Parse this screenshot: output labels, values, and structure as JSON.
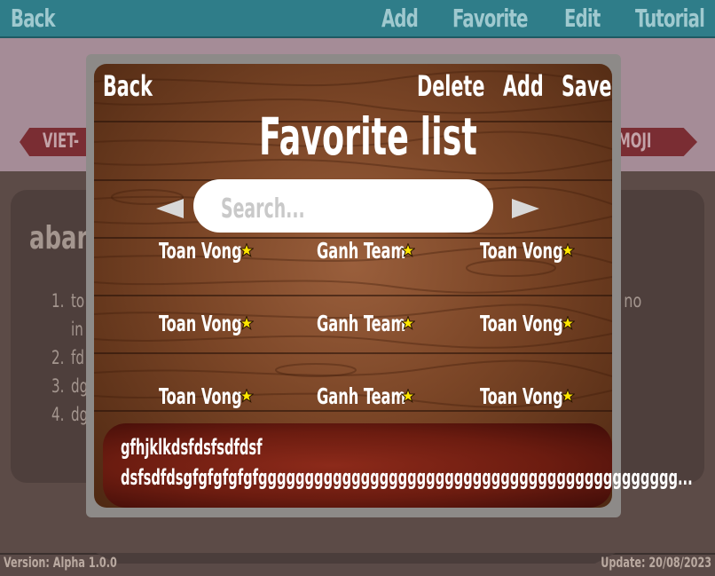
{
  "topbar": {
    "back": "Back",
    "add": "Add",
    "favorite": "Favorite",
    "edit": "Edit",
    "tutorial": "Tutorial"
  },
  "language": {
    "left": "VIET-",
    "right": "MOJI"
  },
  "word_panel": {
    "title": "aband",
    "definitions": [
      {
        "num": "1.",
        "text": "to"
      },
      {
        "num": "",
        "text": "in"
      },
      {
        "num": "2.",
        "text": "fd"
      },
      {
        "num": "3.",
        "text": "dg"
      },
      {
        "num": "4.",
        "text": "dg"
      }
    ],
    "right_fragment": "h  no"
  },
  "footer": {
    "version": "Version: Alpha 1.0.0",
    "update": "Update: 20/08/2023"
  },
  "modal": {
    "back": "Back",
    "delete": "Delete",
    "add": "Add",
    "save": "Save",
    "title": "Favorite list",
    "search_placeholder": "Search...",
    "items": [
      "Toan Vong",
      "Ganh Team",
      "Toan Vong",
      "Toan Vong",
      "Ganh Team",
      "Toan Vong",
      "Toan Vong",
      "Ganh Team",
      "Toan Vong"
    ],
    "star_icon": "star-icon",
    "star_color": "#ffe600",
    "description_line1": "gfhjklkdsfdsfsdfdsf",
    "description_line2": "dsfsdfdsgfgfgfgfgfggggggggggggggggggggggggggggggggggggggggggggg..."
  },
  "colors": {
    "topbar": "#2f7d89",
    "modal_frame": "#8d8a88",
    "description_box": "#8c2a1a"
  }
}
